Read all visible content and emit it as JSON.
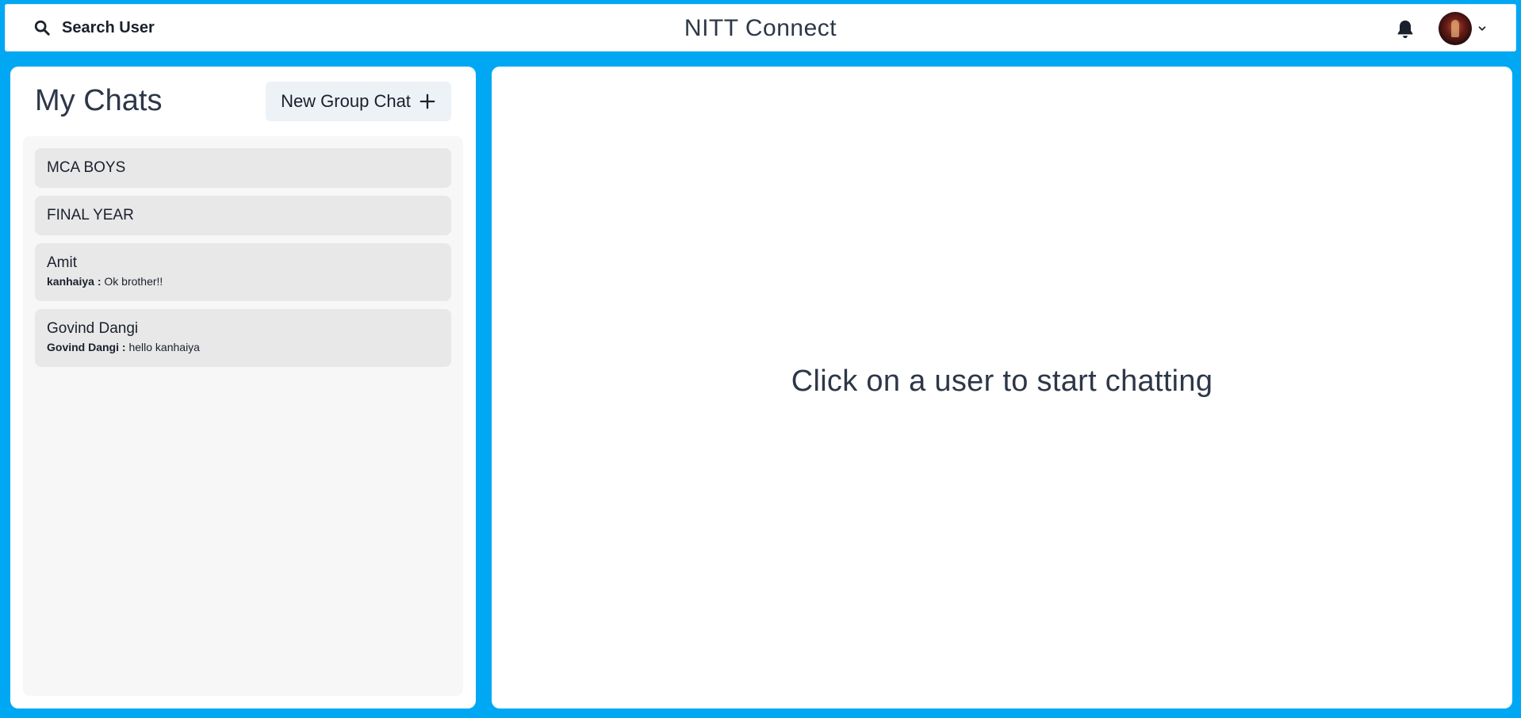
{
  "header": {
    "search_label": "Search User",
    "app_title": "NITT Connect",
    "icons": {
      "search": "search-icon",
      "bell": "bell-icon",
      "chevron": "chevron-down-icon"
    }
  },
  "sidebar": {
    "title": "My Chats",
    "new_group_label": "New Group Chat",
    "chats": [
      {
        "name": "MCA BOYS",
        "sender": "",
        "message": ""
      },
      {
        "name": "FINAL YEAR",
        "sender": "",
        "message": ""
      },
      {
        "name": "Amit",
        "sender": "kanhaiya :",
        "message": "Ok brother!!"
      },
      {
        "name": "Govind Dangi",
        "sender": "Govind Dangi :",
        "message": "hello kanhaiya"
      }
    ]
  },
  "chat_box": {
    "empty_message": "Click on a user to start chatting"
  },
  "colors": {
    "background": "#00a8f3",
    "panel": "#ffffff",
    "chat_item": "#e8e8e8",
    "list_box": "#f7f7f7",
    "button": "#edf2f7"
  }
}
